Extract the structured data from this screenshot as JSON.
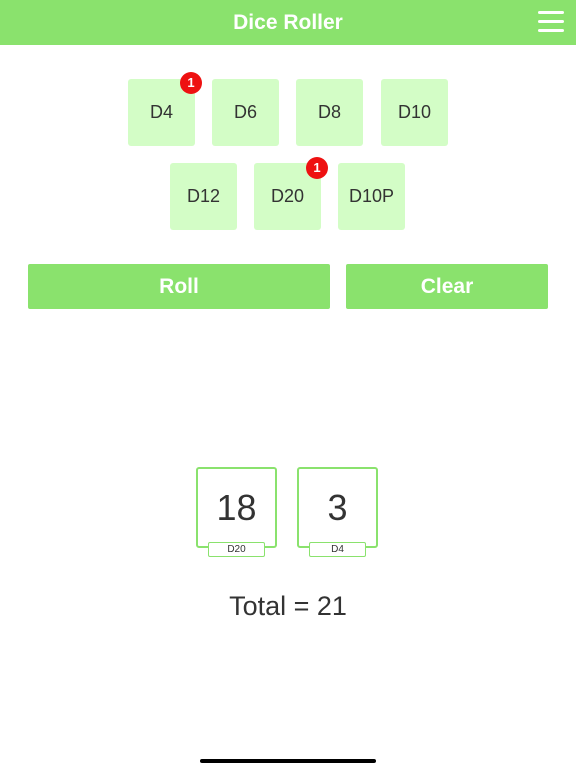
{
  "navbar": {
    "title": "Dice Roller",
    "menu_icon": "hamburger-menu-icon",
    "color": "#8ae26d"
  },
  "dice": {
    "row1": [
      {
        "label": "D4",
        "badge": "1"
      },
      {
        "label": "D6",
        "badge": ""
      },
      {
        "label": "D8",
        "badge": ""
      },
      {
        "label": "D10",
        "badge": ""
      }
    ],
    "row2": [
      {
        "label": "D12",
        "badge": ""
      },
      {
        "label": "D20",
        "badge": "1"
      },
      {
        "label": "D10P",
        "badge": ""
      }
    ],
    "button_color": "#d3fdc6",
    "badge_color": "#ee1111"
  },
  "actions": {
    "roll_label": "Roll",
    "clear_label": "Clear"
  },
  "results": [
    {
      "value": "18",
      "die": "D20"
    },
    {
      "value": "3",
      "die": "D4"
    }
  ],
  "total_text": "Total = 21"
}
